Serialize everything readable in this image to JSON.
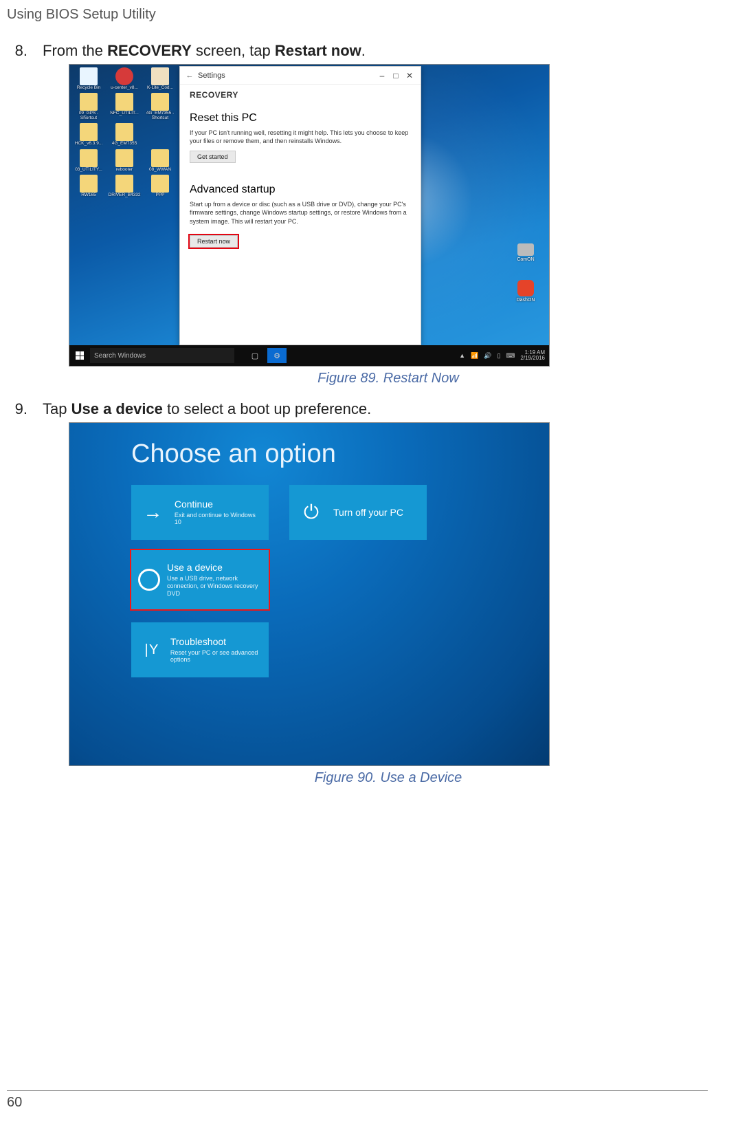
{
  "page": {
    "header": "Using BIOS Setup Utility",
    "number": "60"
  },
  "step8": {
    "num": "8.",
    "pre": "From the ",
    "b1": "RECOVERY",
    "mid": " screen, tap ",
    "b2": "Restart now",
    "post": "."
  },
  "step9": {
    "num": "9.",
    "pre": "Tap ",
    "b1": "Use a device",
    "post": " to select a boot up preference."
  },
  "fig89": {
    "caption": "Figure 89.  Restart Now",
    "desktopIcons": [
      "Recycle Bin",
      "u-center_v8...",
      "K-Lite_Cod...",
      "09_GPS - Shortcut",
      "NFC_UTILIT...",
      "4G_EM7355 - Shortcut",
      "HCK_v6.3.9...",
      "4G_EM7355",
      "",
      "03_UTILITY...",
      "rebooter",
      "08_WWAN",
      "RW165",
      "DRIVER_B4332",
      "PPP"
    ],
    "rightIcons": {
      "cam": "CamON",
      "dash": "DashON"
    },
    "settings": {
      "titlebar": "Settings",
      "heading": "RECOVERY",
      "reset_h": "Reset this PC",
      "reset_p": "If your PC isn't running well, resetting it might help. This lets you choose to keep your files or remove them, and then reinstalls Windows.",
      "reset_btn": "Get started",
      "adv_h": "Advanced startup",
      "adv_p": "Start up from a device or disc (such as a USB drive or DVD), change your PC's firmware settings, change Windows startup settings, or restore Windows from a system image. This will restart your PC.",
      "adv_btn": "Restart now"
    },
    "taskbar": {
      "search_placeholder": "Search Windows",
      "time": "1:19 AM",
      "date": "2/19/2016"
    }
  },
  "fig90": {
    "caption": "Figure 90.  Use a Device",
    "title": "Choose an option",
    "continue_t": "Continue",
    "continue_s": "Exit and continue to Windows 10",
    "turnoff_t": "Turn off your PC",
    "device_t": "Use a device",
    "device_s": "Use a USB drive, network connection, or Windows recovery DVD",
    "trouble_t": "Troubleshoot",
    "trouble_s": "Reset your PC or see advanced options"
  }
}
